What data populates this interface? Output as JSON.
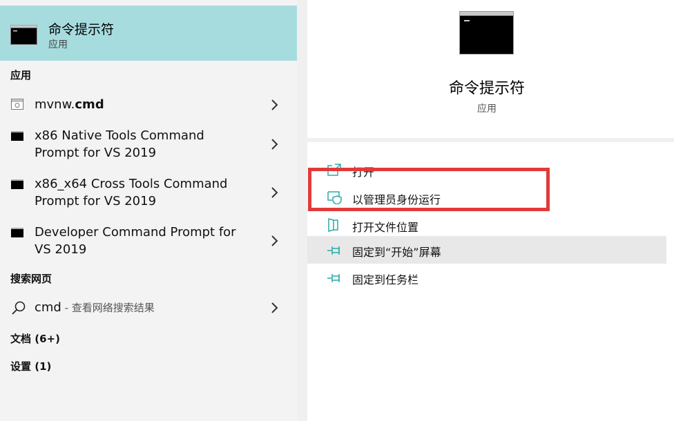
{
  "best_match": {
    "title": "命令提示符",
    "subtitle": "应用",
    "icon": "terminal-icon"
  },
  "sections": {
    "apps": "应用",
    "web": "搜索网页",
    "docs": "文档 (6+)",
    "settings": "设置 (1)"
  },
  "app_results": [
    {
      "name_plain": "mvnw.",
      "name_bold": "cmd",
      "icon": "file-script-icon"
    },
    {
      "line1": "x86 Native Tools Command",
      "line2": "Prompt for VS 2019",
      "icon": "terminal-icon"
    },
    {
      "line1": "x86_x64 Cross Tools Command",
      "line2": "Prompt for VS 2019",
      "icon": "terminal-icon"
    },
    {
      "line1": "Developer Command Prompt for",
      "line2": "VS 2019",
      "icon": "terminal-icon"
    }
  ],
  "web_result": {
    "query": "cmd",
    "hint": " - 查看网络搜索结果",
    "icon": "search-icon"
  },
  "detail": {
    "title": "命令提示符",
    "subtitle": "应用",
    "actions": [
      {
        "label": "打开",
        "icon": "open-icon"
      },
      {
        "label": "以管理员身份运行",
        "icon": "admin-shield-icon"
      },
      {
        "label": "打开文件位置",
        "icon": "folder-location-icon"
      },
      {
        "label": "固定到“开始”屏幕",
        "icon": "pin-icon"
      },
      {
        "label": "固定到任务栏",
        "icon": "pin-icon"
      }
    ]
  },
  "colors": {
    "accent": "#a7dcdf",
    "highlight_box": "#e23a3a",
    "icon_teal": "#2aa8a8"
  }
}
